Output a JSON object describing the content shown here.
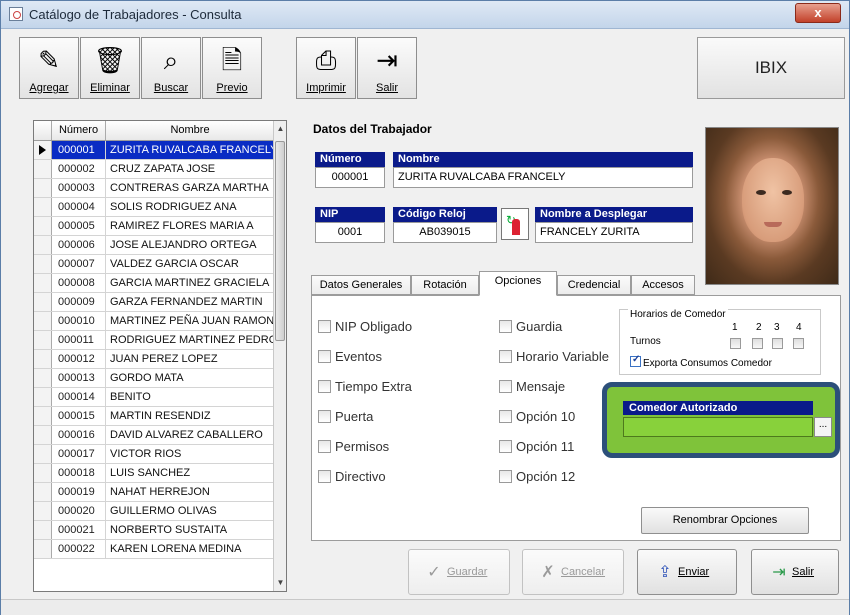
{
  "window": {
    "title": "Catálogo de Trabajadores - Consulta",
    "close_label": "x"
  },
  "toolbar": {
    "buttons": [
      {
        "label": "Agregar",
        "icon": "pencil-paper-icon"
      },
      {
        "label": "Eliminar",
        "icon": "trash-can-icon"
      },
      {
        "label": "Buscar",
        "icon": "binoculars-icon"
      },
      {
        "label": "Previo",
        "icon": "print-preview-icon"
      },
      {
        "label": "Imprimir",
        "icon": "printer-icon"
      },
      {
        "label": "Salir",
        "icon": "exit-door-icon"
      }
    ],
    "brand": "IBIX"
  },
  "table": {
    "headers": {
      "numero": "Número",
      "nombre": "Nombre"
    },
    "rows": [
      {
        "numero": "000001",
        "nombre": "ZURITA RUVALCABA FRANCELY"
      },
      {
        "numero": "000002",
        "nombre": "CRUZ ZAPATA JOSE"
      },
      {
        "numero": "000003",
        "nombre": "CONTRERAS GARZA MARTHA"
      },
      {
        "numero": "000004",
        "nombre": "SOLIS RODRIGUEZ ANA"
      },
      {
        "numero": "000005",
        "nombre": "RAMIREZ FLORES MARIA A"
      },
      {
        "numero": "000006",
        "nombre": "JOSE ALEJANDRO ORTEGA"
      },
      {
        "numero": "000007",
        "nombre": "VALDEZ GARCIA OSCAR"
      },
      {
        "numero": "000008",
        "nombre": "GARCIA MARTINEZ GRACIELA"
      },
      {
        "numero": "000009",
        "nombre": "GARZA FERNANDEZ MARTIN"
      },
      {
        "numero": "000010",
        "nombre": "MARTINEZ PEÑA JUAN RAMON"
      },
      {
        "numero": "000011",
        "nombre": "RODRIGUEZ MARTINEZ PEDRO"
      },
      {
        "numero": "000012",
        "nombre": "JUAN PEREZ LOPEZ"
      },
      {
        "numero": "000013",
        "nombre": "GORDO MATA"
      },
      {
        "numero": "000014",
        "nombre": "BENITO"
      },
      {
        "numero": "000015",
        "nombre": "MARTIN RESENDIZ"
      },
      {
        "numero": "000016",
        "nombre": "DAVID ALVAREZ CABALLERO"
      },
      {
        "numero": "000017",
        "nombre": "VICTOR RIOS"
      },
      {
        "numero": "000018",
        "nombre": "LUIS SANCHEZ"
      },
      {
        "numero": "000019",
        "nombre": "NAHAT HERREJON"
      },
      {
        "numero": "000020",
        "nombre": "GUILLERMO OLIVAS"
      },
      {
        "numero": "000021",
        "nombre": "NORBERTO SUSTAITA"
      },
      {
        "numero": "000022",
        "nombre": "KAREN LORENA MEDINA"
      }
    ],
    "selected_index": 0
  },
  "details": {
    "section_title": "Datos del Trabajador",
    "numero": {
      "label": "Número",
      "value": "000001"
    },
    "nombre": {
      "label": "Nombre",
      "value": "ZURITA RUVALCABA FRANCELY"
    },
    "nip": {
      "label": "NIP",
      "value": "0001"
    },
    "codigo_reloj": {
      "label": "Código Reloj",
      "value": "AB039015"
    },
    "nombre_desplegar": {
      "label": "Nombre a Desplegar",
      "value": "FRANCELY ZURITA"
    }
  },
  "tabs": [
    {
      "label": "Datos Generales",
      "active": false
    },
    {
      "label": "Rotación",
      "active": false
    },
    {
      "label": "Opciones",
      "active": true
    },
    {
      "label": "Credencial",
      "active": false
    },
    {
      "label": "Accesos",
      "active": false
    }
  ],
  "options": {
    "left": [
      "NIP Obligado",
      "Eventos",
      "Tiempo Extra",
      "Puerta",
      "Permisos",
      "Directivo"
    ],
    "right": [
      "Guardia",
      "Horario Variable",
      "Mensaje",
      "Opción 10",
      "Opción 11",
      "Opción 12"
    ]
  },
  "comedor": {
    "group_title": "Horarios de Comedor",
    "turnos_label": "Turnos",
    "turnos": [
      "1",
      "2",
      "3",
      "4"
    ],
    "exporta_label": "Exporta Consumos Comedor",
    "exporta_checked": true,
    "autorizado_label": "Comedor Autorizado",
    "autorizado_value": "",
    "lookup_label": "..."
  },
  "buttons": {
    "renombrar": "Renombrar Opciones",
    "guardar": "Guardar",
    "cancelar": "Cancelar",
    "enviar": "Enviar",
    "salir": "Salir"
  },
  "colors": {
    "selection": "#0a2cc4",
    "label_bar": "#0a1a8a",
    "highlight": "#7fc33a"
  }
}
